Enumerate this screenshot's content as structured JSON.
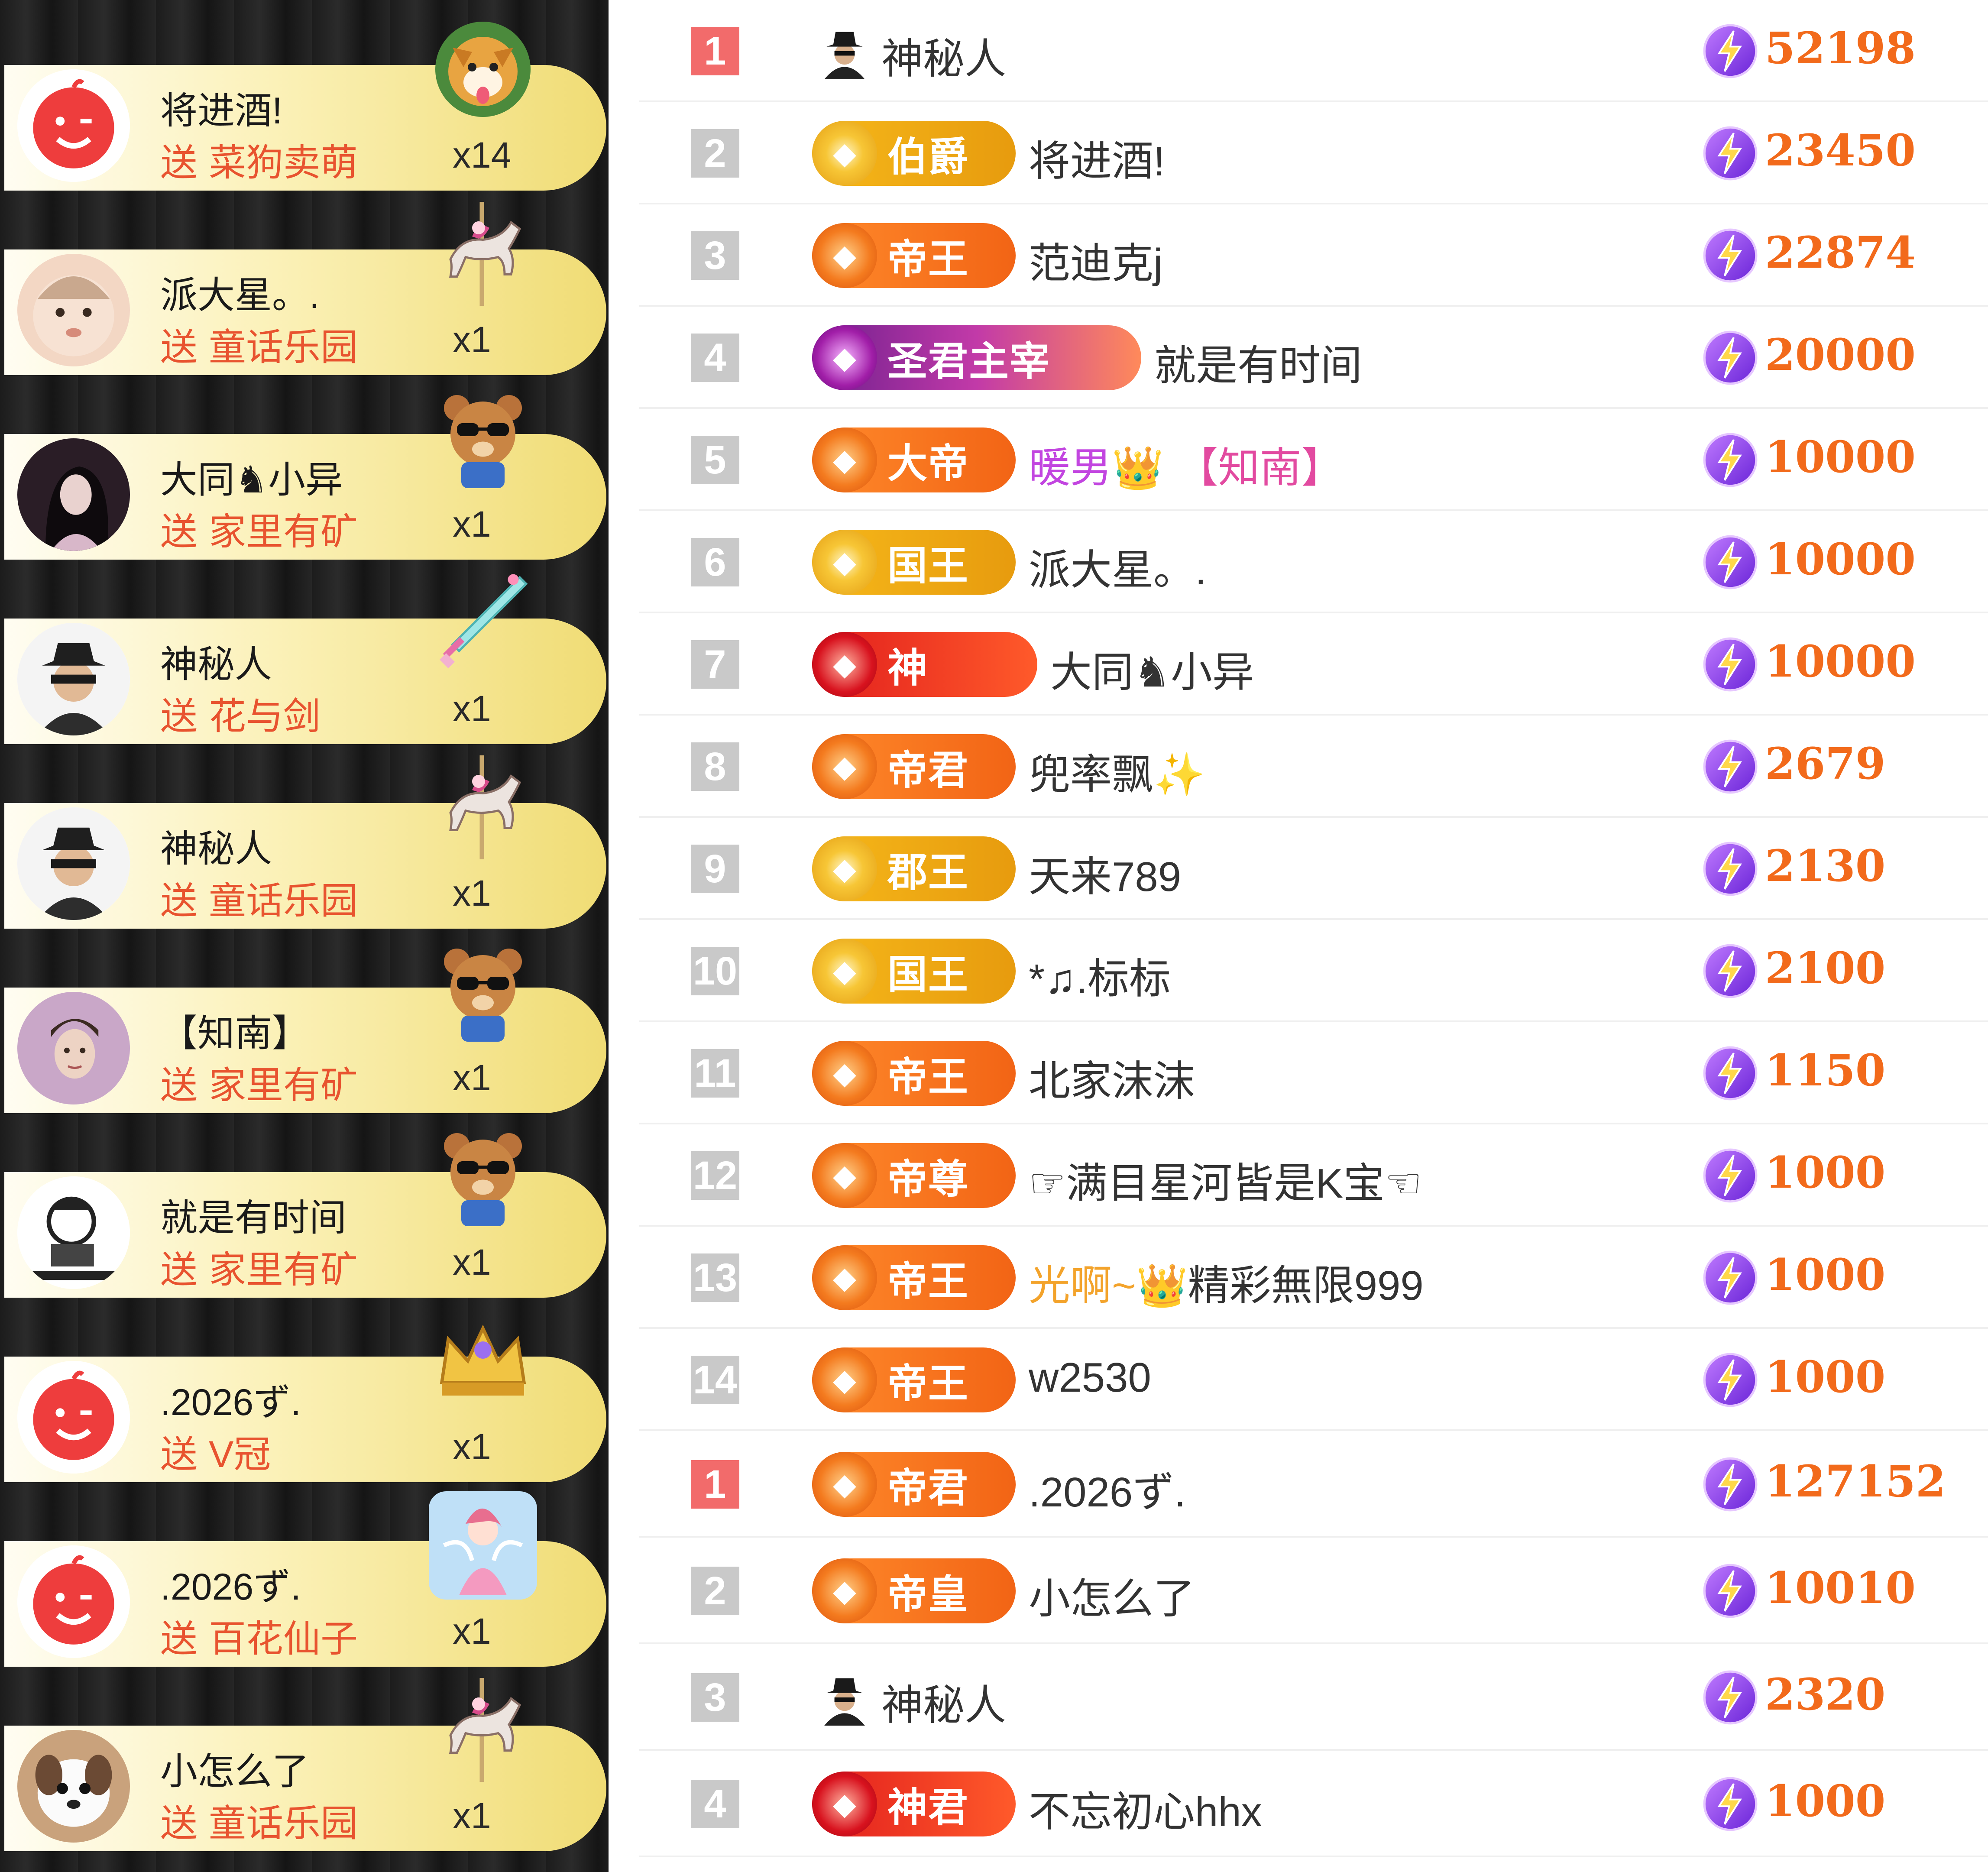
{
  "gift_feed": [
    {
      "name": "将进酒!",
      "verb": "送",
      "gift": "菜狗卖萌",
      "count": "x14",
      "avatar_icon": "red-face-avatar-icon",
      "gift_icon": "shiba-dog-icon"
    },
    {
      "name": "派大星。.",
      "verb": "送",
      "gift": "童话乐园",
      "count": "x1",
      "avatar_icon": "baby-photo-avatar-icon",
      "gift_icon": "carousel-horse-icon"
    },
    {
      "name": "大同♞小异",
      "verb": "送",
      "gift": "家里有矿",
      "count": "x1",
      "avatar_icon": "woman-photo-avatar-icon",
      "gift_icon": "bear-sunglasses-icon"
    },
    {
      "name": "神秘人",
      "verb": "送",
      "gift": "花与剑",
      "count": "x1",
      "avatar_icon": "mystery-man-avatar-icon",
      "gift_icon": "sword-icon"
    },
    {
      "name": "神秘人",
      "verb": "送",
      "gift": "童话乐园",
      "count": "x1",
      "avatar_icon": "mystery-man-avatar-icon",
      "gift_icon": "carousel-horse-icon"
    },
    {
      "name": "【知南】",
      "verb": "送",
      "gift": "家里有矿",
      "count": "x1",
      "avatar_icon": "man-photo-avatar-icon",
      "gift_icon": "bear-sunglasses-icon"
    },
    {
      "name": "就是有时间",
      "verb": "送",
      "gift": "家里有矿",
      "count": "x1",
      "avatar_icon": "cartoon-avatar-icon",
      "gift_icon": "bear-sunglasses-icon"
    },
    {
      "name": ".2026ず.",
      "verb": "送",
      "gift": "V冠",
      "count": "x1",
      "avatar_icon": "red-face-avatar-icon",
      "gift_icon": "crown-icon"
    },
    {
      "name": ".2026ず.",
      "verb": "送",
      "gift": "百花仙子",
      "count": "x1",
      "avatar_icon": "red-face-avatar-icon",
      "gift_icon": "fairy-icon"
    },
    {
      "name": "小怎么了",
      "verb": "送",
      "gift": "童话乐园",
      "count": "x1",
      "avatar_icon": "puppy-photo-avatar-icon",
      "gift_icon": "carousel-horse-icon"
    }
  ],
  "ranking": [
    {
      "rank": "1",
      "top": true,
      "badge": null,
      "name_parts": [
        {
          "text": "神秘人",
          "style": ""
        }
      ],
      "score": "52198"
    },
    {
      "rank": "2",
      "top": false,
      "badge": {
        "label": "伯爵",
        "style": "gold"
      },
      "name_parts": [
        {
          "text": "将进酒!",
          "style": ""
        }
      ],
      "score": "23450"
    },
    {
      "rank": "3",
      "top": false,
      "badge": {
        "label": "帝王",
        "style": "orange"
      },
      "name_parts": [
        {
          "text": "范迪克j",
          "style": ""
        }
      ],
      "score": "22874"
    },
    {
      "rank": "4",
      "top": false,
      "badge": {
        "label": "圣君主宰",
        "style": "purple"
      },
      "name_parts": [
        {
          "text": "就是有时间",
          "style": ""
        }
      ],
      "score": "20000"
    },
    {
      "rank": "5",
      "top": false,
      "badge": {
        "label": "大帝",
        "style": "orange"
      },
      "name_parts": [
        {
          "text": "暖男👑",
          "style": "pink"
        },
        {
          "text": "【知南】",
          "style": "tag"
        }
      ],
      "score": "10000"
    },
    {
      "rank": "6",
      "top": false,
      "badge": {
        "label": "国王",
        "style": "gold"
      },
      "name_parts": [
        {
          "text": "派大星。.",
          "style": ""
        }
      ],
      "score": "10000"
    },
    {
      "rank": "7",
      "top": false,
      "badge": {
        "label": "神",
        "style": "red"
      },
      "name_parts": [
        {
          "text": "大同♞小异",
          "style": ""
        }
      ],
      "score": "10000"
    },
    {
      "rank": "8",
      "top": false,
      "badge": {
        "label": "帝君",
        "style": "orange"
      },
      "name_parts": [
        {
          "text": "兜率飘✨",
          "style": ""
        }
      ],
      "score": "2679"
    },
    {
      "rank": "9",
      "top": false,
      "badge": {
        "label": "郡王",
        "style": "gold"
      },
      "name_parts": [
        {
          "text": "天来789",
          "style": ""
        }
      ],
      "score": "2130"
    },
    {
      "rank": "10",
      "top": false,
      "badge": {
        "label": "国王",
        "style": "gold"
      },
      "name_parts": [
        {
          "text": "*♫.标标",
          "style": ""
        }
      ],
      "score": "2100"
    },
    {
      "rank": "11",
      "top": false,
      "badge": {
        "label": "帝王",
        "style": "orange"
      },
      "name_parts": [
        {
          "text": "北家沫沫",
          "style": ""
        }
      ],
      "score": "1150"
    },
    {
      "rank": "12",
      "top": false,
      "badge": {
        "label": "帝尊",
        "style": "orange"
      },
      "name_parts": [
        {
          "text": "☞满目星河皆是K宝☜",
          "style": ""
        }
      ],
      "score": "1000"
    },
    {
      "rank": "13",
      "top": false,
      "badge": {
        "label": "帝王",
        "style": "orange"
      },
      "name_parts": [
        {
          "text": "光啊~👑",
          "style": "orange"
        },
        {
          "text": "精彩無限999",
          "style": ""
        }
      ],
      "score": "1000"
    },
    {
      "rank": "14",
      "top": false,
      "badge": {
        "label": "帝王",
        "style": "orange"
      },
      "name_parts": [
        {
          "text": "w2530",
          "style": ""
        }
      ],
      "score": "1000"
    },
    {
      "rank": "1",
      "top": true,
      "badge": {
        "label": "帝君",
        "style": "orange"
      },
      "name_parts": [
        {
          "text": ".2026ず.",
          "style": ""
        }
      ],
      "score": "127152"
    },
    {
      "rank": "2",
      "top": false,
      "badge": {
        "label": "帝皇",
        "style": "orange"
      },
      "name_parts": [
        {
          "text": "小怎么了",
          "style": ""
        }
      ],
      "score": "10010"
    },
    {
      "rank": "3",
      "top": false,
      "badge": null,
      "name_parts": [
        {
          "text": "神秘人",
          "style": ""
        }
      ],
      "score": "2320"
    },
    {
      "rank": "4",
      "top": false,
      "badge": {
        "label": "神君",
        "style": "red"
      },
      "name_parts": [
        {
          "text": "不忘初心hhx",
          "style": ""
        }
      ],
      "score": "1000"
    }
  ],
  "colors": {
    "score": "#f26a1b",
    "gift_text": "#e8532f",
    "rank_top": "#f26b6b",
    "rank_default": "#c9c9c9",
    "coin": "#8a3df0"
  }
}
